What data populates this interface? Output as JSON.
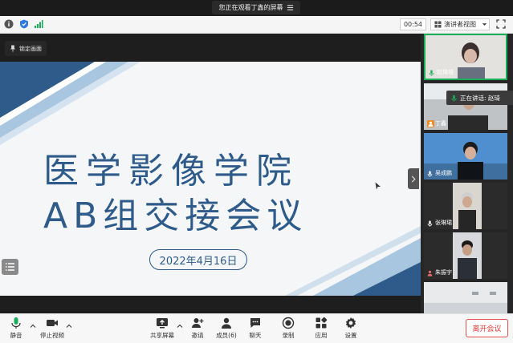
{
  "banner": {
    "text": "您正在观看丁鑫的屏幕"
  },
  "toolbar": {
    "timer": "00:54",
    "view_mode": "演讲者视图"
  },
  "stage": {
    "lock_label": "锁定画面",
    "slide": {
      "title_line1": "医学影像学院",
      "title_line2": "AB组交接会议",
      "date": "2022年4月16日"
    }
  },
  "panel": {
    "speaking_label": "正在讲话: 赵琦",
    "participants": [
      {
        "name": "赵琦培"
      },
      {
        "name": "丁鑫"
      },
      {
        "name": "吴成鹏"
      },
      {
        "name": "张琳珺"
      },
      {
        "name": "朱振宇"
      }
    ]
  },
  "bottom": {
    "mute": "静音",
    "stop_video": "停止视频",
    "share": "共享屏幕",
    "invite": "邀请",
    "members": "成员(6)",
    "chat": "聊天",
    "record": "录制",
    "apps": "应用",
    "settings": "设置",
    "leave": "离开会议"
  },
  "colors": {
    "accent": "#2e5b8a",
    "leave": "#e03a3a",
    "mic": "#1aad5a"
  }
}
